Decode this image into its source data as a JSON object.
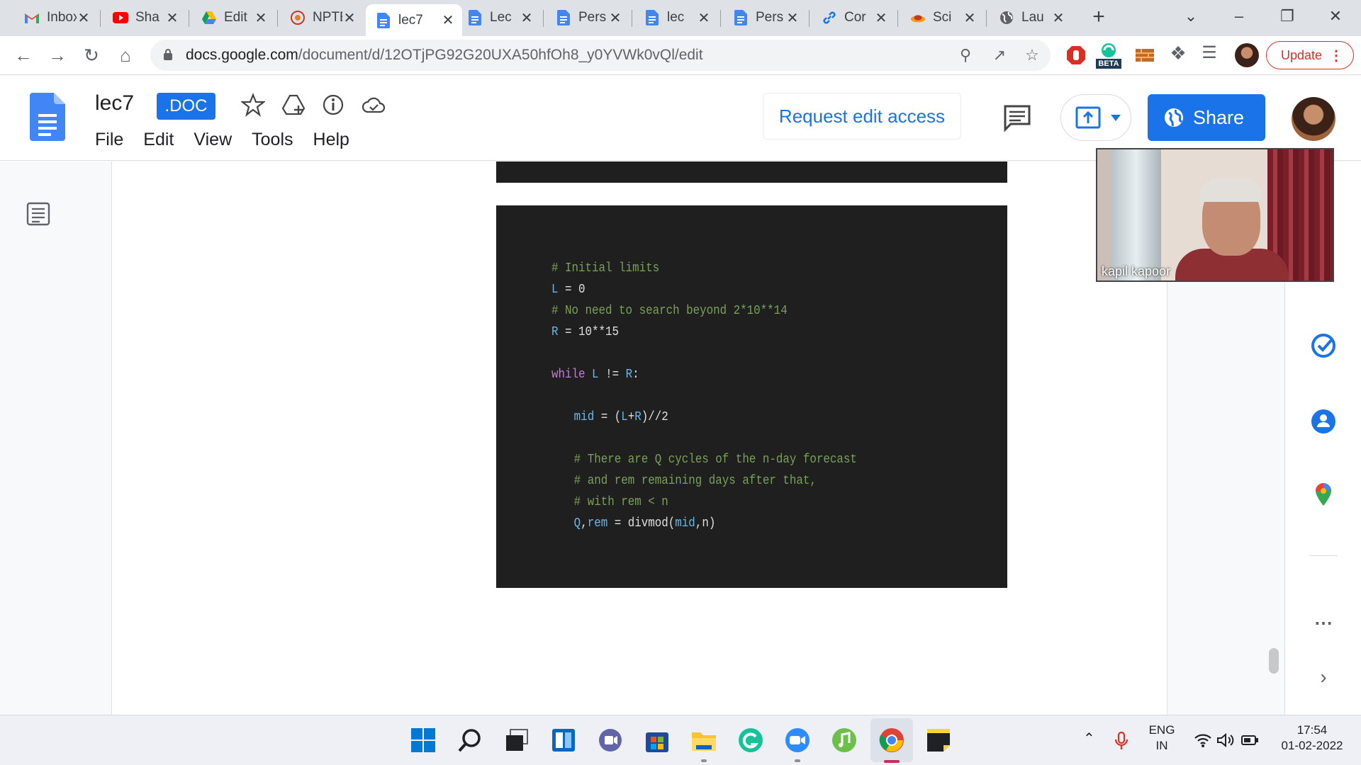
{
  "browser": {
    "tabs": [
      {
        "title": "Inbox",
        "icon": "gmail-icon"
      },
      {
        "title": "Sha",
        "icon": "youtube-icon"
      },
      {
        "title": "Edit",
        "icon": "google-drive-icon"
      },
      {
        "title": "NPTEL",
        "icon": "nptel-icon"
      },
      {
        "title": "lec7",
        "icon": "google-docs-icon",
        "active": true
      },
      {
        "title": "Lec",
        "icon": "google-docs-icon"
      },
      {
        "title": "Pers",
        "icon": "google-docs-icon"
      },
      {
        "title": "lec",
        "icon": "google-docs-icon"
      },
      {
        "title": "Pers",
        "icon": "google-docs-icon"
      },
      {
        "title": "Cor",
        "icon": "link-icon"
      },
      {
        "title": "Sci",
        "icon": "sci-icon"
      },
      {
        "title": "Lau",
        "icon": "globe-icon"
      }
    ],
    "url_host": "docs.google.com",
    "url_path": "/document/d/12OTjPG92G20UXA50hfOh8_y0YVWk0vQl/edit",
    "update_label": "Update",
    "extension_badge": "BETA"
  },
  "doc": {
    "title": "lec7",
    "badge": ".DOC",
    "menu": [
      "File",
      "Edit",
      "View",
      "Tools",
      "Help"
    ],
    "request_edit_label": "Request edit access",
    "share_label": "Share",
    "accent": "#1a73e8"
  },
  "code_lines": [
    {
      "indent": 0,
      "parts": [
        {
          "t": "# Initial limits",
          "c": "cm"
        }
      ]
    },
    {
      "indent": 0,
      "parts": [
        {
          "t": "L",
          "c": "var"
        },
        {
          "t": " = 0",
          "c": "op"
        }
      ]
    },
    {
      "indent": 0,
      "parts": [
        {
          "t": "# No need to search beyond 2*10**14",
          "c": "cm"
        }
      ]
    },
    {
      "indent": 0,
      "parts": [
        {
          "t": "R",
          "c": "var"
        },
        {
          "t": " = 10**15",
          "c": "op"
        }
      ]
    },
    {
      "indent": 0,
      "parts": []
    },
    {
      "indent": 0,
      "parts": [
        {
          "t": "while",
          "c": "kw"
        },
        {
          "t": " ",
          "c": "op"
        },
        {
          "t": "L",
          "c": "var"
        },
        {
          "t": " != ",
          "c": "op"
        },
        {
          "t": "R",
          "c": "var"
        },
        {
          "t": ":",
          "c": "op"
        }
      ]
    },
    {
      "indent": 0,
      "parts": []
    },
    {
      "indent": 1,
      "parts": [
        {
          "t": "mid",
          "c": "var"
        },
        {
          "t": " = (",
          "c": "op"
        },
        {
          "t": "L",
          "c": "var"
        },
        {
          "t": "+",
          "c": "op"
        },
        {
          "t": "R",
          "c": "var"
        },
        {
          "t": ")//2",
          "c": "op"
        }
      ]
    },
    {
      "indent": 0,
      "parts": []
    },
    {
      "indent": 1,
      "parts": [
        {
          "t": "# There are Q cycles of the n-day forecast",
          "c": "cm"
        }
      ]
    },
    {
      "indent": 1,
      "parts": [
        {
          "t": "# and rem remaining days after that,",
          "c": "cm"
        }
      ]
    },
    {
      "indent": 1,
      "parts": [
        {
          "t": "# with rem < n",
          "c": "cm"
        }
      ]
    },
    {
      "indent": 1,
      "parts": [
        {
          "t": "Q",
          "c": "var"
        },
        {
          "t": ",",
          "c": "op"
        },
        {
          "t": "rem",
          "c": "var"
        },
        {
          "t": " = divmod(",
          "c": "op"
        },
        {
          "t": "mid",
          "c": "var"
        },
        {
          "t": ",n)",
          "c": "op"
        }
      ]
    }
  ],
  "video": {
    "participant_name": "kapil kapoor"
  },
  "taskbar": {
    "apps": [
      "windows-start-icon",
      "search-icon",
      "task-view-icon",
      "widgets-icon",
      "teams-chat-icon",
      "microsoft-store-icon",
      "file-explorer-icon",
      "grammarly-icon",
      "zoom-icon",
      "music-icon",
      "chrome-icon",
      "sticky-notes-icon"
    ],
    "language_line1": "ENG",
    "language_line2": "IN",
    "time": "17:54",
    "date": "01-02-2022"
  }
}
